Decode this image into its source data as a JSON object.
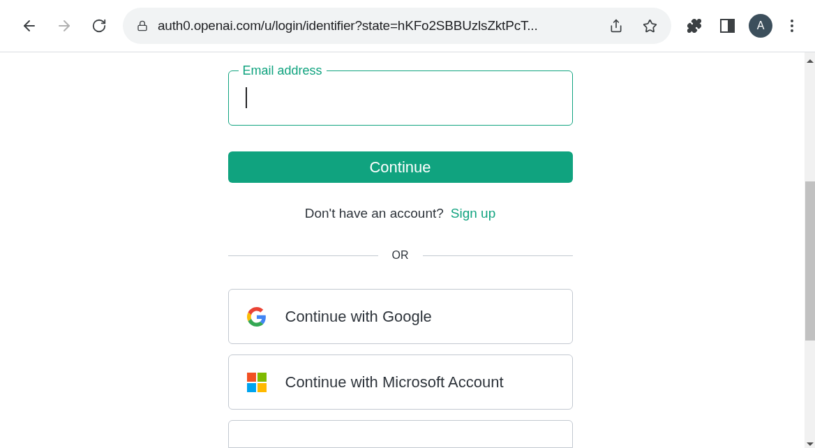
{
  "browser": {
    "back": {
      "disabled": false
    },
    "forward": {
      "disabled": true
    },
    "url": "auth0.openai.com/u/login/identifier?state=hKFo2SBBUzlsZktPcT...",
    "profile_initial": "A"
  },
  "login": {
    "email_field": {
      "label": "Email address"
    },
    "continue_button": "Continue",
    "signup_prompt": "Don't have an account?",
    "signup_link": "Sign up",
    "divider_text": "OR",
    "providers": [
      {
        "kind": "google",
        "label": "Continue with Google"
      },
      {
        "kind": "microsoft",
        "label": "Continue with Microsoft Account"
      }
    ]
  }
}
